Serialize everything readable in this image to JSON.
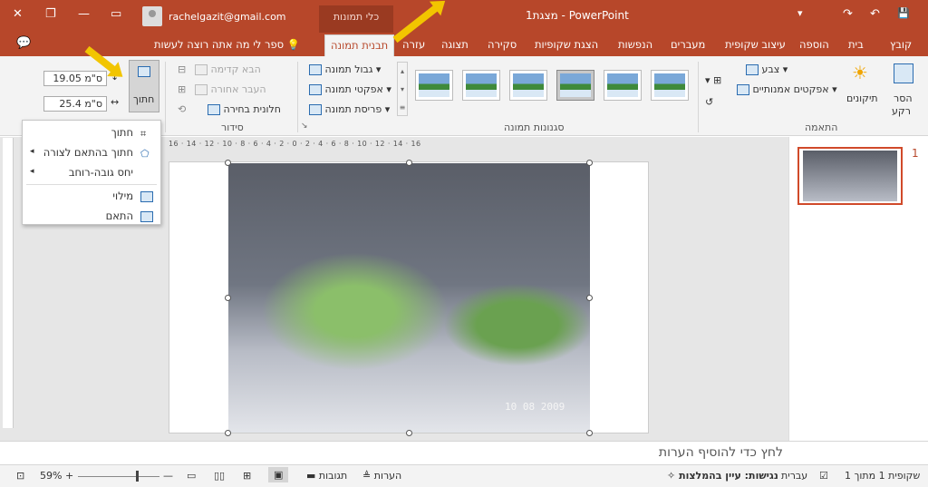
{
  "titlebar": {
    "app_title": "PowerPoint - מצגת1",
    "tools_tab": "כלי תמונות",
    "user_email": "rachelgazit@gmail.com",
    "window_controls": {
      "close": "✕",
      "restore": "❐",
      "minimize": "—",
      "ribbon_display": "▭"
    },
    "qat": {
      "save": "💾",
      "undo": "↶",
      "redo": "↷",
      "customize": "▾"
    }
  },
  "tabs": {
    "file": "קובץ",
    "home": "בית",
    "insert": "הוספה",
    "design": "עיצוב שקופית",
    "transitions": "מעברים",
    "animations": "הנפשות",
    "slideshow": "הצגת שקופיות",
    "review": "סקירה",
    "view": "תצוגה",
    "help": "עזרה",
    "picture_format": "תבנית תמונה",
    "tell_me": "ספר לי מה אתה רוצה לעשות"
  },
  "ribbon": {
    "adjust": {
      "label": "התאמה",
      "remove_bg": "הסר",
      "remove_bg_2": "רקע",
      "corrections": "תיקונים",
      "color": "צבע",
      "artistic": "אפקטים אמנותיים"
    },
    "styles": {
      "label": "סגנונות תמונה",
      "border": "גבול תמונה",
      "effects": "אפקטי תמונה",
      "layout": "פריסת תמונה"
    },
    "arrange": {
      "label": "סידור",
      "bring_forward": "הבא קדימה",
      "send_backward": "העבר אחורה",
      "selection_pane": "חלונית בחירה"
    },
    "size": {
      "crop": "חתוך",
      "height": "19.05 ס\"מ",
      "width": "25.4 ס\"מ"
    }
  },
  "crop_menu": {
    "items": [
      "חתוך",
      "חתוך בהתאם לצורה",
      "יחס גובה-רוחב",
      "מילוי",
      "התאם"
    ]
  },
  "ruler": "16 · 14 · 12 · 10 · 8 · 6 · 4 · 2 · 0 · 2 · 4 · 6 · 8 · 10 · 12 · 14 · 16",
  "photo": {
    "date_stamp": "10 08 2009"
  },
  "thumbnails": {
    "slide_number": "1"
  },
  "notes": {
    "placeholder": "לחץ כדי להוסיף הערות"
  },
  "statusbar": {
    "slide_info": "שקופית 1 מתוך 1",
    "language": "עברית",
    "accessibility": "נגישות: עיין בהמלצות",
    "notes": "הערות",
    "comments": "תגובות",
    "zoom": "59%"
  },
  "colors": {
    "accent": "#b7472a",
    "arrow": "#f2c500"
  }
}
